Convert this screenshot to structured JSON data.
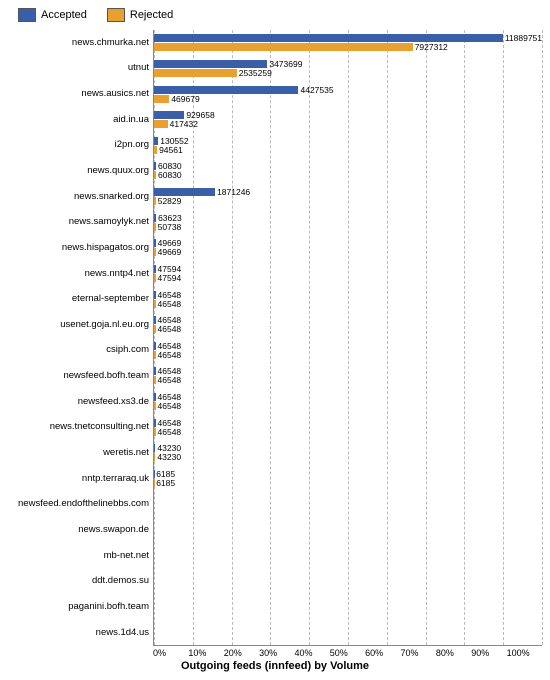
{
  "legend": {
    "accepted_label": "Accepted",
    "rejected_label": "Rejected"
  },
  "title": "Outgoing feeds (innfeed) by Volume",
  "x_axis_labels": [
    "0%",
    "10%",
    "20%",
    "30%",
    "40%",
    "50%",
    "60%",
    "70%",
    "80%",
    "90%",
    "100%"
  ],
  "max_value": 11889751,
  "bars": [
    {
      "label": "news.chmurka.net",
      "accepted": 11889751,
      "rejected": 7927312
    },
    {
      "label": "utnut",
      "accepted": 3473699,
      "rejected": 2535259
    },
    {
      "label": "news.ausics.net",
      "accepted": 4427535,
      "rejected": 469679
    },
    {
      "label": "aid.in.ua",
      "accepted": 929658,
      "rejected": 417432
    },
    {
      "label": "i2pn.org",
      "accepted": 130552,
      "rejected": 94561
    },
    {
      "label": "news.quux.org",
      "accepted": 60830,
      "rejected": 60830
    },
    {
      "label": "news.snarked.org",
      "accepted": 1871246,
      "rejected": 52829
    },
    {
      "label": "news.samoylyk.net",
      "accepted": 63623,
      "rejected": 50738
    },
    {
      "label": "news.hispagatos.org",
      "accepted": 49669,
      "rejected": 49669
    },
    {
      "label": "news.nntp4.net",
      "accepted": 47594,
      "rejected": 47594
    },
    {
      "label": "eternal-september",
      "accepted": 46548,
      "rejected": 46548
    },
    {
      "label": "usenet.goja.nl.eu.org",
      "accepted": 46548,
      "rejected": 46548
    },
    {
      "label": "csiph.com",
      "accepted": 46548,
      "rejected": 46548
    },
    {
      "label": "newsfeed.bofh.team",
      "accepted": 46548,
      "rejected": 46548
    },
    {
      "label": "newsfeed.xs3.de",
      "accepted": 46548,
      "rejected": 46548
    },
    {
      "label": "news.tnetconsulting.net",
      "accepted": 46548,
      "rejected": 46548
    },
    {
      "label": "weretis.net",
      "accepted": 43230,
      "rejected": 43230
    },
    {
      "label": "nntp.terraraq.uk",
      "accepted": 6185,
      "rejected": 6185
    },
    {
      "label": "newsfeed.endofthelinebbs.com",
      "accepted": 0,
      "rejected": 0
    },
    {
      "label": "news.swapon.de",
      "accepted": 0,
      "rejected": 0
    },
    {
      "label": "mb-net.net",
      "accepted": 0,
      "rejected": 0
    },
    {
      "label": "ddt.demos.su",
      "accepted": 0,
      "rejected": 0
    },
    {
      "label": "paganini.bofh.team",
      "accepted": 0,
      "rejected": 0
    },
    {
      "label": "news.1d4.us",
      "accepted": 0,
      "rejected": 0
    }
  ]
}
